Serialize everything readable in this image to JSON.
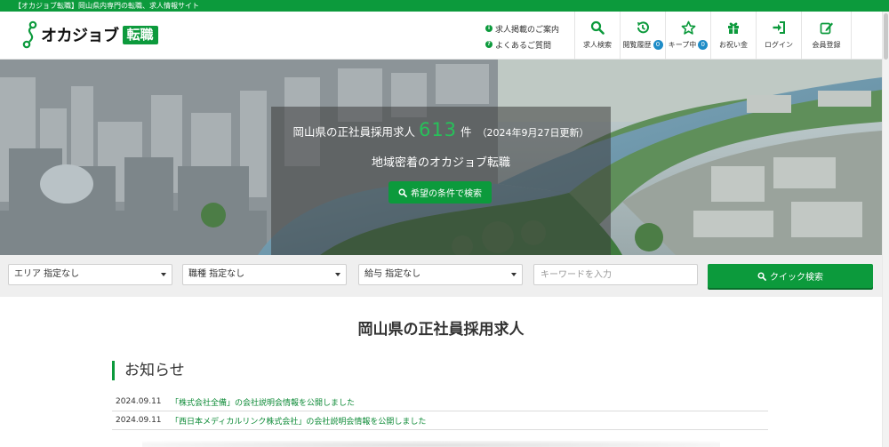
{
  "topbar": {
    "text": "【オカジョブ転職】岡山県内専門の転職、求人情報サイト"
  },
  "logo": {
    "text": "オカジョブ",
    "badge": "転職"
  },
  "header_links": [
    {
      "label": "求人掲載のご案内",
      "icon": "info-icon"
    },
    {
      "label": "よくあるご質問",
      "icon": "question-icon"
    }
  ],
  "nav": [
    {
      "label": "求人検索",
      "icon": "search-icon"
    },
    {
      "label": "閲覧履歴",
      "icon": "history-icon",
      "badge": "0"
    },
    {
      "label": "キープ中",
      "icon": "star-icon",
      "badge": "0"
    },
    {
      "label": "お祝い金",
      "icon": "gift-icon"
    },
    {
      "label": "ログイン",
      "icon": "login-icon"
    },
    {
      "label": "会員登録",
      "icon": "register-icon"
    }
  ],
  "hero": {
    "prefix": "岡山県の正社員採用求人",
    "count": "613",
    "unit": "件",
    "updated": "（2024年9月27日更新）",
    "tagline": "地域密着のオカジョブ転職",
    "button": "希望の条件で検索"
  },
  "search": {
    "area": "エリア 指定なし",
    "job_type": "職種 指定なし",
    "salary": "給与 指定なし",
    "keyword_placeholder": "キーワードを入力",
    "submit": "クイック検索"
  },
  "main_title": "岡山県の正社員採用求人",
  "news": {
    "heading": "お知らせ",
    "items": [
      {
        "date": "2024.09.11",
        "title": "「株式会社全備」の会社説明会情報を公開しました"
      },
      {
        "date": "2024.09.11",
        "title": "「西日本メディカルリンク株式会社」の会社説明会情報を公開しました"
      }
    ]
  },
  "colors": {
    "brand": "#0c9a3c",
    "badge": "#1e8cc7",
    "count": "#27c15a"
  }
}
